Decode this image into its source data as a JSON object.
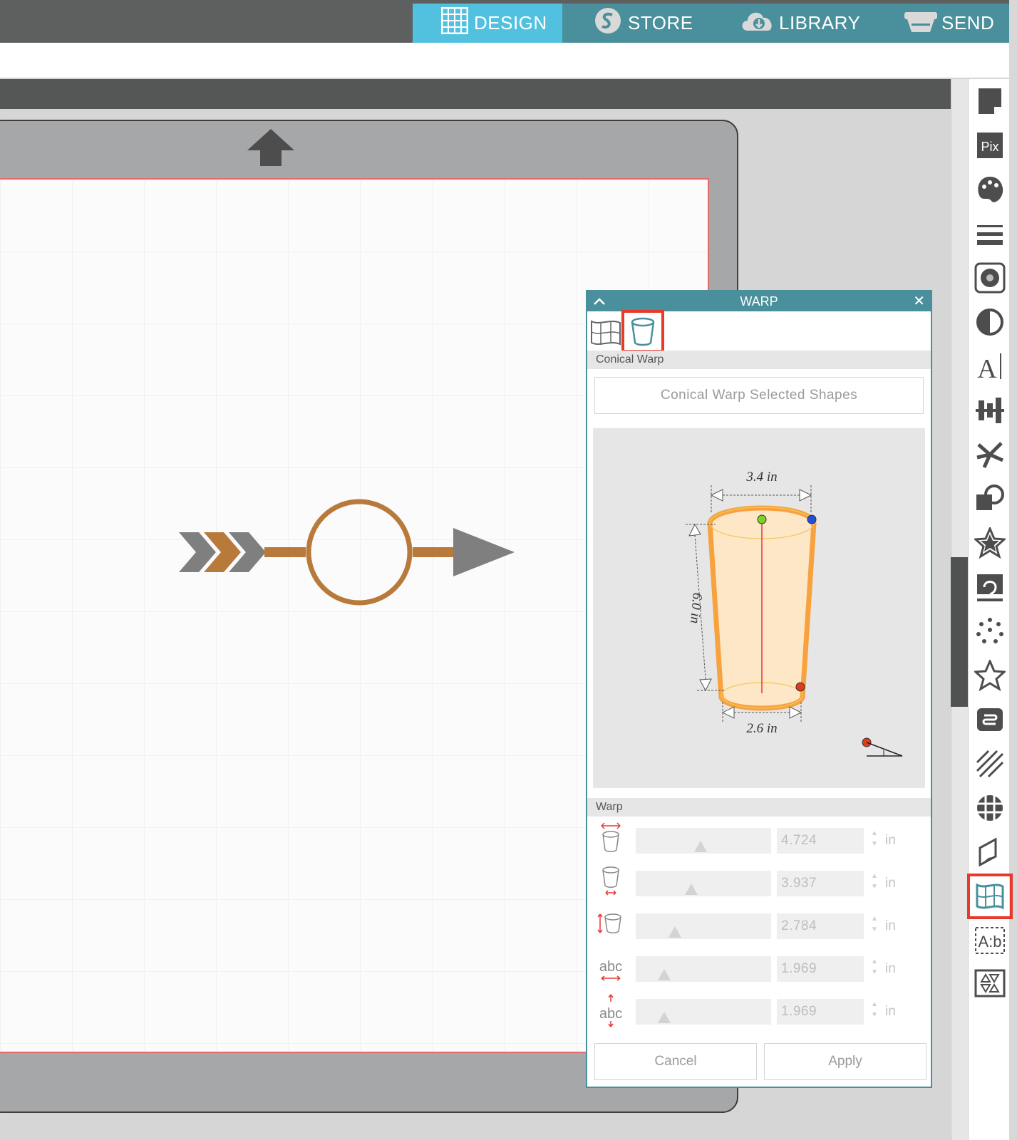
{
  "nav": {
    "tabs": [
      {
        "label": "DESIGN",
        "icon": "grid-icon",
        "active": true
      },
      {
        "label": "STORE",
        "icon": "silhouette-s-icon",
        "active": false
      },
      {
        "label": "LIBRARY",
        "icon": "cloud-download-icon",
        "active": false
      },
      {
        "label": "SEND",
        "icon": "cutter-icon",
        "active": false
      }
    ]
  },
  "colors": {
    "nav_bg": "#4a8f9c",
    "nav_active": "#52c1df",
    "highlight": "#e8392a",
    "shape_brown": "#b87a3b",
    "shape_gray": "#7f7f7f"
  },
  "right_toolbar": {
    "items": [
      "page-setup-icon",
      "pixscan-icon",
      "fill-color-icon",
      "line-style-icon",
      "fill-pattern-icon",
      "transparency-icon",
      "text-style-icon",
      "align-icon",
      "replicate-icon",
      "modify-icon",
      "offset-icon",
      "trace-icon",
      "point-edit-icon",
      "knife-icon",
      "transform-icon",
      "sketch-icon",
      "image-effects-icon",
      "3d-fold-icon",
      "warp-icon",
      "text-to-path-icon",
      "library-triangles-icon"
    ],
    "selected": "warp-icon"
  },
  "warp_panel": {
    "title": "WARP",
    "close_glyph": "✕",
    "collapse_glyph": "^",
    "section_conical": "Conical Warp",
    "apply_shapes_button": "Conical Warp Selected Shapes",
    "diagram": {
      "top_width": "3.4 in",
      "height": "6.0 in",
      "bottom_width": "2.6 in"
    },
    "section_warp": "Warp",
    "rows": [
      {
        "icon": "cup-top-width-icon",
        "value": "4.724",
        "unit": "in",
        "slider": 0.48
      },
      {
        "icon": "cup-bottom-width-icon",
        "value": "3.937",
        "unit": "in",
        "slider": 0.41
      },
      {
        "icon": "cup-height-icon",
        "value": "2.784",
        "unit": "in",
        "slider": 0.29
      },
      {
        "icon": "text-width-icon",
        "value": "1.969",
        "unit": "in",
        "slider": 0.21
      },
      {
        "icon": "text-height-icon",
        "value": "1.969",
        "unit": "in",
        "slider": 0.21
      }
    ],
    "cancel_label": "Cancel",
    "apply_label": "Apply"
  }
}
